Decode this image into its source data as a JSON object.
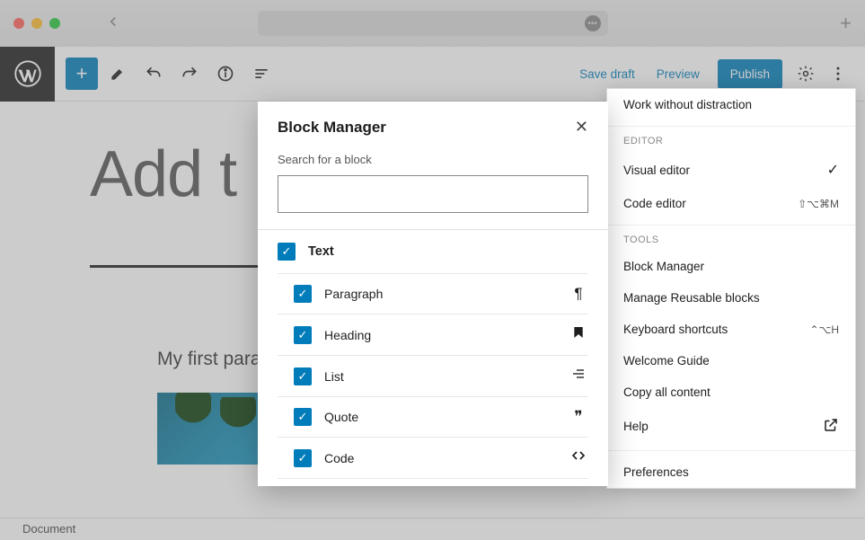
{
  "titlebar": {
    "addr_hint": ""
  },
  "toolbar": {
    "save_draft": "Save draft",
    "preview": "Preview",
    "publish": "Publish"
  },
  "editor": {
    "title_placeholder": "Add t",
    "paragraph": "My first parag",
    "status": "Document"
  },
  "side_menu": {
    "top_item": "Work without distraction",
    "editor_header": "EDITOR",
    "visual_editor": "Visual editor",
    "code_editor": "Code editor",
    "code_editor_shortcut": "⇧⌥⌘M",
    "tools_header": "TOOLS",
    "block_manager": "Block Manager",
    "manage_reusable": "Manage Reusable blocks",
    "keyboard_shortcuts": "Keyboard shortcuts",
    "keyboard_shortcuts_shortcut": "⌃⌥H",
    "welcome_guide": "Welcome Guide",
    "copy_all": "Copy all content",
    "help": "Help",
    "preferences": "Preferences"
  },
  "modal": {
    "title": "Block Manager",
    "search_label": "Search for a block",
    "category": "Text",
    "blocks": [
      {
        "label": "Paragraph",
        "icon": "¶"
      },
      {
        "label": "Heading",
        "icon": "🔖"
      },
      {
        "label": "List",
        "icon": "≔"
      },
      {
        "label": "Quote",
        "icon": "❞"
      },
      {
        "label": "Code",
        "icon": "‹›"
      }
    ]
  }
}
